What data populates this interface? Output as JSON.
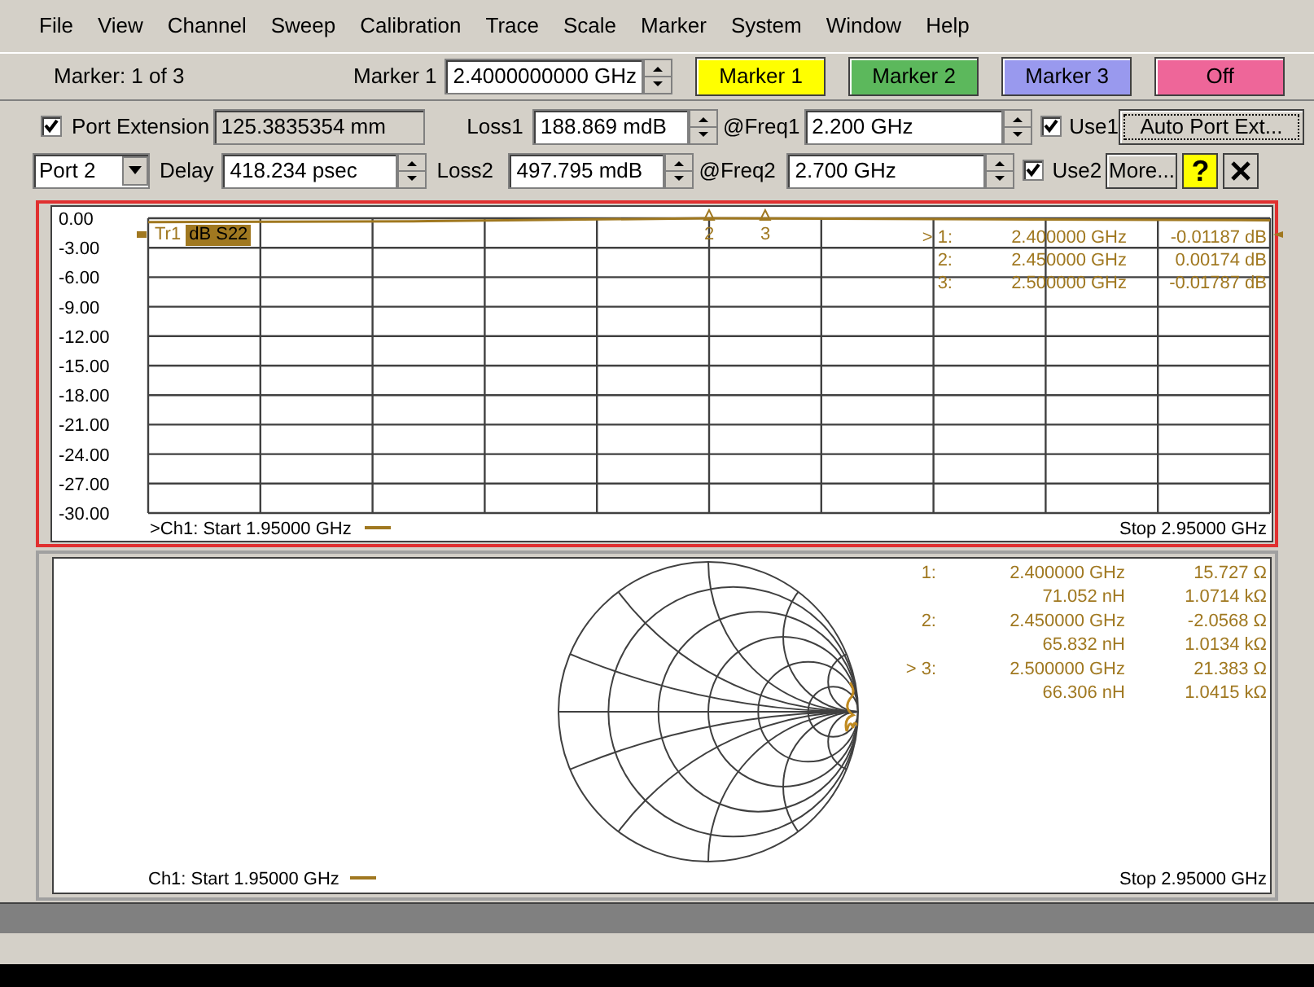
{
  "menu": [
    "File",
    "View",
    "Channel",
    "Sweep",
    "Calibration",
    "Trace",
    "Scale",
    "Marker",
    "System",
    "Window",
    "Help"
  ],
  "marker_bar": {
    "status": "Marker: 1 of 3",
    "field_label": "Marker 1",
    "field_value": "2.4000000000 GHz",
    "buttons": [
      {
        "label": "Marker 1",
        "color": "#ffff00"
      },
      {
        "label": "Marker 2",
        "color": "#5cb85c"
      },
      {
        "label": "Marker 3",
        "color": "#9999ee"
      },
      {
        "label": "Off",
        "color": "#ee6699"
      }
    ]
  },
  "port_extension": {
    "enabled": true,
    "label": "Port Extension",
    "length": "125.3835354 mm",
    "port": "Port 2",
    "delay_label": "Delay",
    "delay": "418.234 psec",
    "rows": [
      {
        "loss_label": "Loss1",
        "loss": "188.869 mdB",
        "freq_label": "@Freq1",
        "freq": "2.200 GHz",
        "use_label": "Use1",
        "use": true
      },
      {
        "loss_label": "Loss2",
        "loss": "497.795 mdB",
        "freq_label": "@Freq2",
        "freq": "2.700 GHz",
        "use_label": "Use2",
        "use": true
      }
    ],
    "auto_button": "Auto Port Ext...",
    "more_button": "More...",
    "help_button": "?"
  },
  "trace_panel": {
    "trace_name": "Tr1",
    "trace_measure": "dB S22",
    "start": ">Ch1: Start  1.95000 GHz",
    "stop": "Stop 2.95000 GHz",
    "marker_flags": [
      {
        "label": "2"
      },
      {
        "label": "3"
      }
    ],
    "markers": [
      {
        "label": "> 1:",
        "freq": "2.400000 GHz",
        "value": "-0.01187 dB"
      },
      {
        "label": "2:",
        "freq": "2.450000 GHz",
        "value": "0.00174 dB"
      },
      {
        "label": "3:",
        "freq": "2.500000 GHz",
        "value": "-0.01787 dB"
      }
    ],
    "chart_data": {
      "type": "line",
      "grid": true,
      "ylim": [
        -30,
        0
      ],
      "yticks": [
        {
          "value": 0,
          "label": "0.00"
        },
        {
          "value": -3,
          "label": "-3.00"
        },
        {
          "value": -6,
          "label": "-6.00"
        },
        {
          "value": -9,
          "label": "-9.00"
        },
        {
          "value": -12,
          "label": "-12.00"
        },
        {
          "value": -15,
          "label": "-15.00"
        },
        {
          "value": -18,
          "label": "-18.00"
        },
        {
          "value": -21,
          "label": "-21.00"
        },
        {
          "value": -24,
          "label": "-24.00"
        },
        {
          "value": -27,
          "label": "-27.00"
        },
        {
          "value": -30,
          "label": "-30.00"
        }
      ],
      "categories": [
        null,
        null,
        null,
        null,
        null
      ],
      "series": [
        {
          "color": "#a07820",
          "values": [
            -0.4,
            -0.3,
            0,
            -0.1,
            -0.2
          ]
        }
      ]
    }
  },
  "smith_panel": {
    "start": "Ch1: Start  1.95000 GHz",
    "stop": "Stop 2.95000 GHz",
    "markers": [
      {
        "label": "1:",
        "freq": "2.400000 GHz",
        "resistance": "15.727 Ω",
        "inductance": "71.052 nH",
        "impedance": "1.0714 kΩ"
      },
      {
        "label": "2:",
        "freq": "2.450000 GHz",
        "resistance": "-2.0568 Ω",
        "inductance": "65.832 nH",
        "impedance": "1.0134 kΩ"
      },
      {
        "label": "> 3:",
        "freq": "2.500000 GHz",
        "resistance": "21.383 Ω",
        "inductance": "66.306 nH",
        "impedance": "1.0415 kΩ"
      }
    ]
  }
}
